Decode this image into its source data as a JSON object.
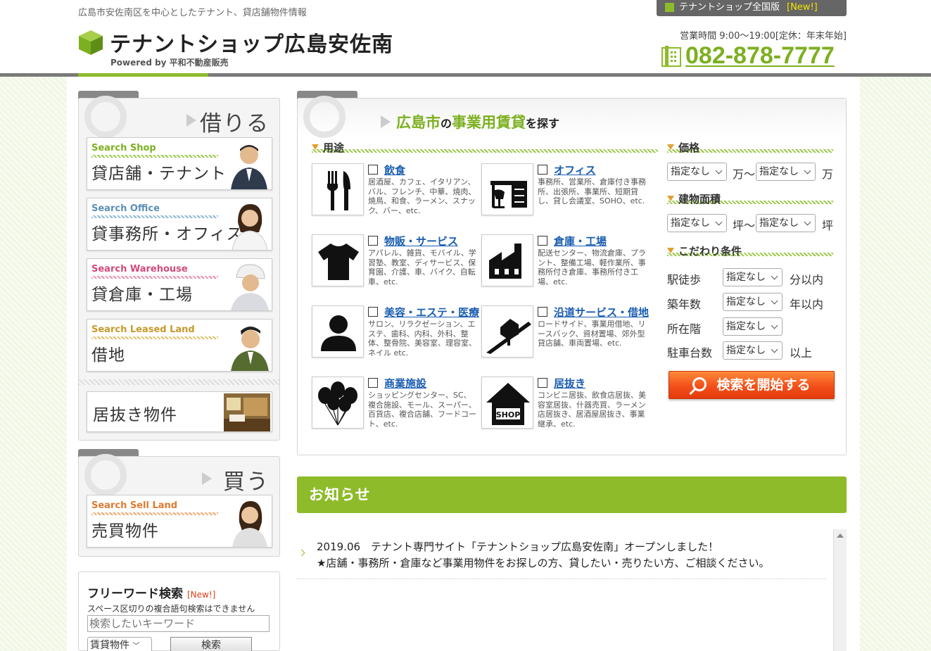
{
  "header": {
    "tagline": "広島市安佐南区を中心としたテナント、貸店舗物件情報",
    "logo_text": "テナントショップ広島安佐南",
    "powered": "Powered by  平和不動産販売",
    "national_label": "テナントショップ全国版",
    "national_new": "[New!]",
    "hours": "営業時間 9:00～19:00[定休：年末年始]",
    "phone": "082-878-7777"
  },
  "sidebar": {
    "rent_title": "借りる",
    "rent_items": [
      {
        "en": "Search Shop",
        "jp": "貸店舗・テナント",
        "color": "#7cb020"
      },
      {
        "en": "Search Office",
        "jp": "貸事務所・オフィス",
        "color": "#5b8fb5"
      },
      {
        "en": "Search Warehouse",
        "jp": "貸倉庫・工場",
        "color": "#d04a7a"
      },
      {
        "en": "Search Leased Land",
        "jp": "借地",
        "color": "#c79a2a"
      }
    ],
    "inuki_label": "居抜き物件",
    "buy_title": "買う",
    "buy_item": {
      "en": "Search Sell Land",
      "jp": "売買物件",
      "color": "#e07a30"
    },
    "freeword": {
      "title": "フリーワード検索",
      "new": "[New!]",
      "note": "スペース区切りの複合語句検索はできません",
      "placeholder": "検索したいキーワード",
      "select_value": "賃貸物件",
      "button": "検索"
    }
  },
  "search": {
    "title_city": "広島市",
    "title_no": "の",
    "title_main": "事業用賃貸",
    "title_end": "を探す",
    "use_heading": "用途",
    "uses": [
      {
        "label": "飲食",
        "desc": "居酒屋、カフェ、イタリアン、バル、フレンチ、中華、焼肉、焼鳥、和食、ラーメン、スナック、バー、etc.",
        "icon": "fork-knife-icon"
      },
      {
        "label": "オフィス",
        "desc": "事務所、営業所、倉庫付き事務所、出張所、事業所、短期貸し、貸し会議室、SOHO、etc.",
        "icon": "office-desk-icon"
      },
      {
        "label": "物販・サービス",
        "desc": "アパレル、雑貨、モバイル、学習塾、教室、ディサービス、保育園、介護、車、バイク、自転車、etc.",
        "icon": "tshirt-icon"
      },
      {
        "label": "倉庫・工場",
        "desc": "配送センター、物流倉庫、プラント、整備工場、軽作業所、事務所付き倉庫、事務所付き工場、etc.",
        "icon": "factory-icon"
      },
      {
        "label": "美容・エステ・医療",
        "desc": "サロン、リラクゼーション、エステ、歯科、内科、外科、整体、整骨院、美容室、理容室、ネイル etc.",
        "icon": "person-icon"
      },
      {
        "label": "沿道サービス・借地",
        "desc": "ロードサイド、事業用借地、リースバック、資材置場、郊外型貸店舗、車両置場、etc.",
        "icon": "roadside-icon"
      },
      {
        "label": "商業施設",
        "desc": "ショッピングセンター、SC、複合施設、モール、スーパー、百貨店、複合店舗、フードコート、etc.",
        "icon": "balloons-icon"
      },
      {
        "label": "居抜き",
        "desc": "コンビニ居抜、飲食店居抜、美容室居抜、什器売買、ラーメン店居抜き、居酒屋居抜き、事業継承、etc.",
        "icon": "shop-house-icon"
      }
    ],
    "price_heading": "価格",
    "price_from": "指定なし",
    "price_unit1": "万～",
    "price_to": "指定なし",
    "price_unit2": "万",
    "area_heading": "建物面積",
    "area_from": "指定なし",
    "area_unit1": "坪～",
    "area_to": "指定なし",
    "area_unit2": "坪",
    "cond_heading": "こだわり条件",
    "conditions": [
      {
        "label": "駅徒歩",
        "value": "指定なし",
        "suffix": "分以内"
      },
      {
        "label": "築年数",
        "value": "指定なし",
        "suffix": "年以内"
      },
      {
        "label": "所在階",
        "value": "指定なし",
        "suffix": ""
      },
      {
        "label": "駐車台数",
        "value": "指定なし",
        "suffix": "以上"
      }
    ],
    "submit": "検索を開始する"
  },
  "news": {
    "heading": "お知らせ",
    "items": [
      {
        "line1": "2019.06　テナント専門サイト「テナントショップ広島安佐南」オープンしました！",
        "line2": "★店舗・事務所・倉庫など事業用物件をお探しの方、貸したい・売りたい方、ご相談ください。"
      }
    ]
  }
}
